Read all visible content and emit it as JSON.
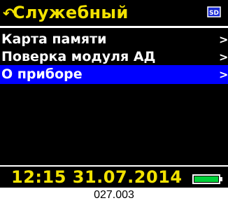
{
  "header": {
    "back_icon": "back-arrow-icon",
    "title": "Служебный",
    "sd_icon": "sd-card-icon",
    "sd_label": "SD"
  },
  "menu": {
    "items": [
      {
        "label": "Карта памяти",
        "selected": false
      },
      {
        "label": "Поверка модуля АД",
        "selected": false
      },
      {
        "label": "О приборе",
        "selected": true
      }
    ],
    "chevron": ">"
  },
  "status": {
    "time": "12:15",
    "date": "31.07.2014",
    "battery_icon": "battery-icon",
    "battery_level": 1.0
  },
  "caption": "027.003",
  "colors": {
    "background": "#000000",
    "title_yellow": "#f2e200",
    "selection_blue": "#0000ff",
    "battery_green": "#00d13a"
  }
}
